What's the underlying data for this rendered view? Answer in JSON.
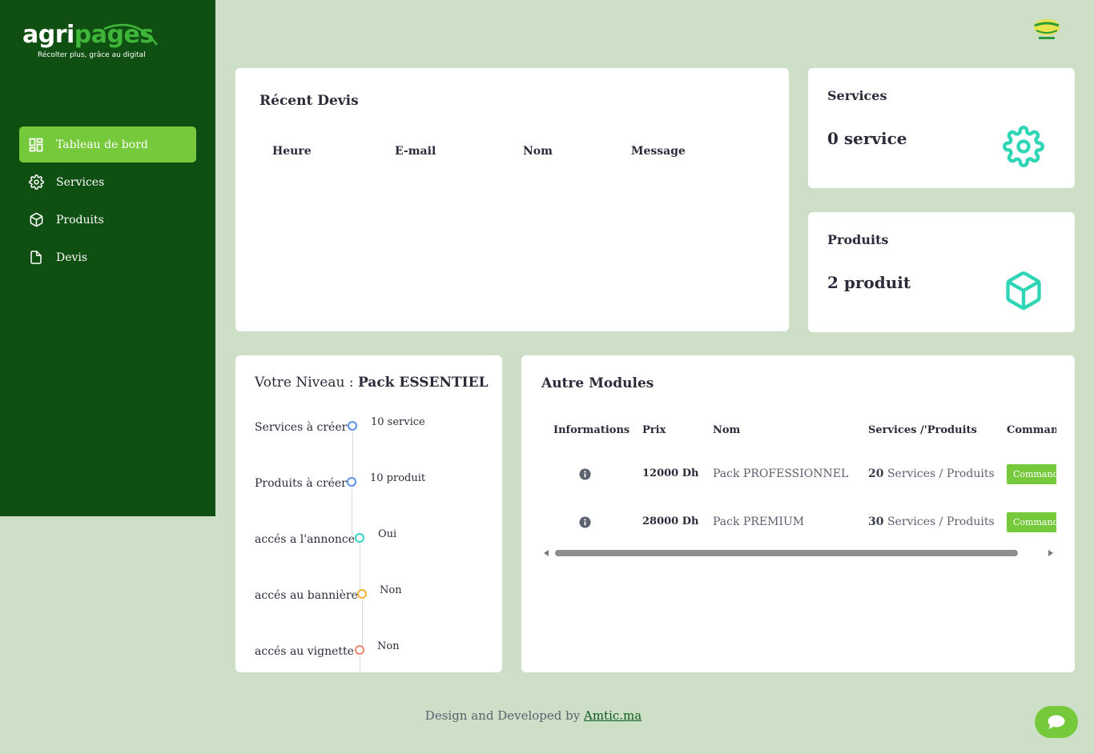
{
  "brand": {
    "logo_part1": "agri",
    "logo_part2": "pages",
    "tagline": "Récolter plus, grâce au digital"
  },
  "sidebar": {
    "items": [
      {
        "label": "Tableau de bord",
        "icon": "dashboard-icon",
        "active": true
      },
      {
        "label": "Services",
        "icon": "gear-icon",
        "active": false
      },
      {
        "label": "Produits",
        "icon": "box-icon",
        "active": false
      },
      {
        "label": "Devis",
        "icon": "document-icon",
        "active": false
      }
    ]
  },
  "recent_devis": {
    "title": "Récent Devis",
    "columns": [
      "Heure",
      "E-mail",
      "Nom",
      "Message"
    ],
    "rows": []
  },
  "services_card": {
    "title": "Services",
    "value": "0 service",
    "icon": "gear-icon"
  },
  "produits_card": {
    "title": "Produits",
    "value": "2 produit",
    "icon": "box-icon"
  },
  "level": {
    "title_prefix": "Votre Niveau : ",
    "title_value": "Pack ESSENTIEL",
    "items": [
      {
        "label": "Services à créer",
        "value": "10 service",
        "color": "#5a8ee8"
      },
      {
        "label": "Produits à créer",
        "value": "10 produit",
        "color": "#5a8ee8"
      },
      {
        "label": "accés a l'annonce",
        "value": "Oui",
        "color": "#2fd6c3"
      },
      {
        "label": "accés au bannière",
        "value": "Non",
        "color": "#f5b12e"
      },
      {
        "label": "accés au vignette",
        "value": "Non",
        "color": "#f0856a"
      }
    ]
  },
  "modules": {
    "title": "Autre Modules",
    "columns": [
      "Informations",
      "Prix",
      "Nom",
      "Services /'Produits",
      "Commande"
    ],
    "rows": [
      {
        "prix": "12000 Dh",
        "nom": "Pack PROFESSIONNEL",
        "count": "20",
        "count_label": "Services / Produits",
        "button": "Commander"
      },
      {
        "prix": "28000 Dh",
        "nom": "Pack PREMIUM",
        "count": "30",
        "count_label": "Services / Produits",
        "button": "Commander"
      }
    ]
  },
  "footer": {
    "text": "Design and Developed by ",
    "link": "Amtic.ma"
  },
  "colors": {
    "sidebar_bg": "#0f4f12",
    "accent_green": "#76c93a",
    "icon_teal": "#2fd6b5",
    "page_bg": "#cddfc6"
  }
}
